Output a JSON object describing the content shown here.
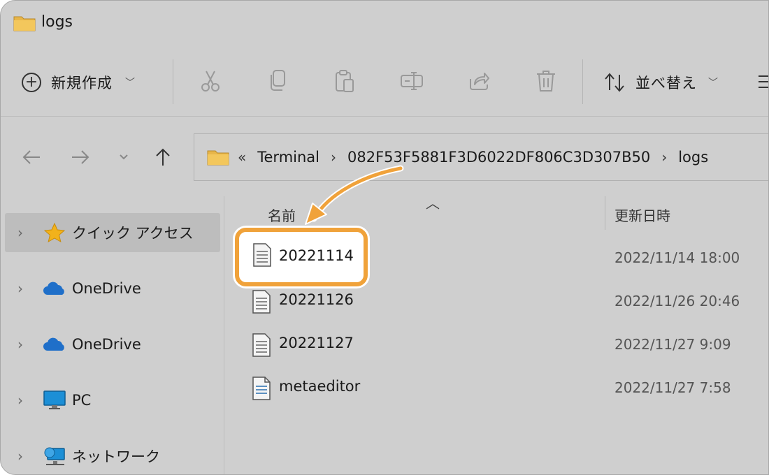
{
  "window": {
    "title": "logs"
  },
  "toolbar": {
    "new_label": "新規作成",
    "sort_label": "並べ替え"
  },
  "address": {
    "overflow": "«",
    "segments": [
      "Terminal",
      "082F53F5881F3D6022DF806C3D307B50",
      "logs"
    ]
  },
  "sidebar": {
    "items": [
      {
        "label": "クイック アクセス",
        "icon": "star-icon"
      },
      {
        "label": "OneDrive",
        "icon": "cloud-icon"
      },
      {
        "label": "OneDrive",
        "icon": "cloud-icon"
      },
      {
        "label": "PC",
        "icon": "monitor-icon"
      },
      {
        "label": "ネットワーク",
        "icon": "network-icon"
      }
    ]
  },
  "filelist": {
    "columns": {
      "name": "名前",
      "date": "更新日時"
    },
    "files": [
      {
        "name": "20221114",
        "date": "2022/11/14 18:00"
      },
      {
        "name": "20221126",
        "date": "2022/11/26 20:46"
      },
      {
        "name": "20221127",
        "date": "2022/11/27 9:09"
      },
      {
        "name": "metaeditor",
        "date": "2022/11/27 7:58"
      }
    ]
  },
  "colors": {
    "highlight": "#f0a23a",
    "star": "#f2b21b",
    "folder": "#e8b64a",
    "cloud": "#1f6fc9"
  }
}
